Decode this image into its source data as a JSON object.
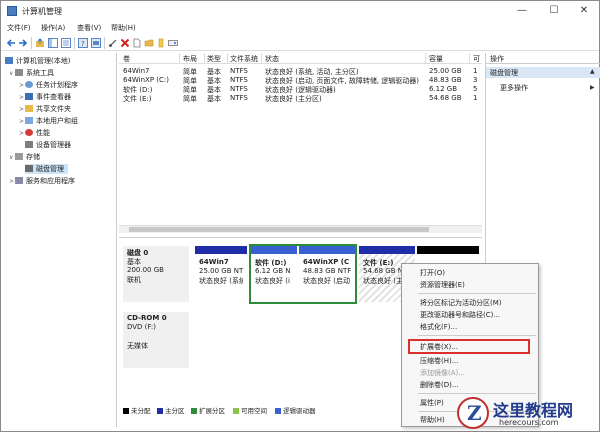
{
  "window": {
    "title": "计算机管理",
    "controls": {
      "minimize": "—",
      "maximize": "☐",
      "close": "✕"
    }
  },
  "menu": [
    "文件(F)",
    "操作(A)",
    "查看(V)",
    "帮助(H)"
  ],
  "tree": [
    {
      "label": "计算机管理(本地)",
      "level": 0,
      "toggle": "",
      "icon": "computer-icon"
    },
    {
      "label": "系统工具",
      "level": 1,
      "toggle": "∨",
      "icon": "tools-icon"
    },
    {
      "label": "任务计划程序",
      "level": 2,
      "toggle": ">",
      "icon": "clock-icon"
    },
    {
      "label": "事件查看器",
      "level": 2,
      "toggle": ">",
      "icon": "event-icon"
    },
    {
      "label": "共享文件夹",
      "level": 2,
      "toggle": ">",
      "icon": "folder-icon"
    },
    {
      "label": "本地用户和组",
      "level": 2,
      "toggle": ">",
      "icon": "users-icon"
    },
    {
      "label": "性能",
      "level": 2,
      "toggle": ">",
      "icon": "performance-icon"
    },
    {
      "label": "设备管理器",
      "level": 2,
      "toggle": "",
      "icon": "device-icon"
    },
    {
      "label": "存储",
      "level": 1,
      "toggle": "∨",
      "icon": "storage-icon"
    },
    {
      "label": "磁盘管理",
      "level": 2,
      "toggle": "",
      "icon": "disk-icon",
      "selected": true
    },
    {
      "label": "服务和应用程序",
      "level": 1,
      "toggle": ">",
      "icon": "services-icon"
    }
  ],
  "volumes": {
    "headers": [
      "卷",
      "布局",
      "类型",
      "文件系统",
      "状态",
      "容量",
      "可"
    ],
    "rows": [
      [
        "64Win7",
        "简单",
        "基本",
        "NTFS",
        "状态良好 (系统, 活动, 主分区)",
        "25.00 GB",
        "1"
      ],
      [
        "64WinXP (C:)",
        "简单",
        "基本",
        "NTFS",
        "状态良好 (启动, 页面文件, 故障转储, 逻辑驱动器)",
        "48.83 GB",
        "3"
      ],
      [
        "软件 (D:)",
        "简单",
        "基本",
        "NTFS",
        "状态良好 (逻辑驱动器)",
        "6.12 GB",
        "5"
      ],
      [
        "文件 (E:)",
        "简单",
        "基本",
        "NTFS",
        "状态良好 (主分区)",
        "54.68 GB",
        "1"
      ]
    ]
  },
  "disks": [
    {
      "name": "磁盘 0",
      "type": "基本",
      "size": "200.00 GB",
      "status": "联机",
      "partitions": [
        {
          "name": "64Win7",
          "size": "25.00 GB NTF",
          "status": "状态良好 (系统"
        },
        {
          "name": "软件 (D:)",
          "size": "6.12 GB N",
          "status": "状态良好 (i"
        },
        {
          "name": "64WinXP (C",
          "size": "48.83 GB NTF",
          "status": "状态良好 (启动"
        },
        {
          "name": "文件 (E:)",
          "size": "54.68 GB NTF",
          "status": "状态良好 (主"
        }
      ]
    },
    {
      "name": "CD-ROM 0",
      "type": "DVD (F:)",
      "size": "",
      "status": "无媒体"
    }
  ],
  "legend": [
    {
      "label": "未分配",
      "color": "#000000"
    },
    {
      "label": "主分区",
      "color": "#1f2ea8"
    },
    {
      "label": "扩展分区",
      "color": "#2e8b3a"
    },
    {
      "label": "可用空间",
      "color": "#8bc34a"
    },
    {
      "label": "逻辑驱动器",
      "color": "#3a5fd0"
    }
  ],
  "actions": {
    "header": "操作",
    "section": "磁盘管理",
    "more": "更多操作"
  },
  "context_menu": {
    "items": [
      {
        "label": "打开(O)",
        "enabled": true
      },
      {
        "label": "资源管理器(E)",
        "enabled": true
      },
      {
        "label": "将分区标记为活动分区(M)",
        "enabled": true
      },
      {
        "label": "更改驱动器号和路径(C)...",
        "enabled": true
      },
      {
        "label": "格式化(F)...",
        "enabled": true
      },
      {
        "label": "扩展卷(X)...",
        "enabled": true,
        "highlighted": true
      },
      {
        "label": "压缩卷(H)...",
        "enabled": true
      },
      {
        "label": "添加镜像(A)...",
        "enabled": false
      },
      {
        "label": "删除卷(D)...",
        "enabled": true
      },
      {
        "label": "属性(P)",
        "enabled": true
      },
      {
        "label": "帮助(H)",
        "enabled": true
      }
    ]
  },
  "watermark": {
    "title": "这里教程网",
    "url": "herecours.com"
  },
  "colors": {
    "primary_partition": "#1f2ea8",
    "logical_drive": "#3a5fd0",
    "extended_partition": "#2e8b3a",
    "highlight_box": "#d9302c",
    "selected_row": "#cce4f7",
    "action_section": "#d9e6f5"
  }
}
